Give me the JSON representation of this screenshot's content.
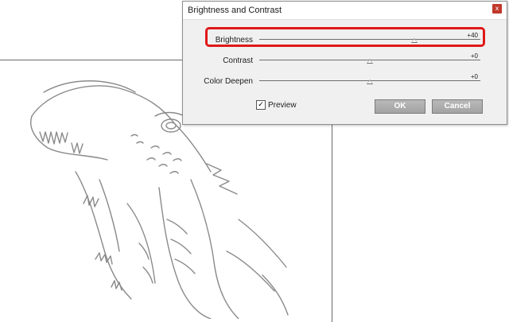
{
  "dialog": {
    "title": "Brightness and Contrast",
    "close_label": "x",
    "sliders": [
      {
        "label": "Brightness",
        "value_text": "+40",
        "level": 0.7
      },
      {
        "label": "Contrast",
        "value_text": "+0",
        "level": 0.5
      },
      {
        "label": "Color Deepen",
        "value_text": "+0",
        "level": 0.5
      }
    ],
    "preview": {
      "label": "Preview",
      "checked": true,
      "check_glyph": "✓"
    },
    "ok_label": "OK",
    "cancel_label": "Cancel"
  },
  "highlight": {
    "color": "#e01818",
    "target": "Brightness"
  },
  "artwork": {
    "subject": "pencil-sketch",
    "stroke_color": "#8a8a8a"
  }
}
